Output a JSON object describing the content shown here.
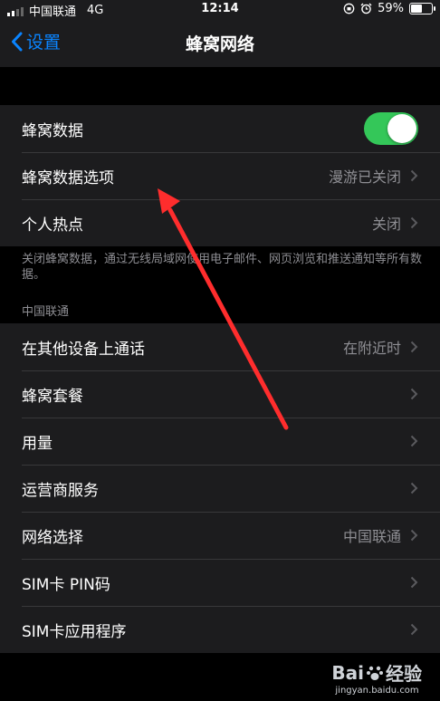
{
  "status_bar": {
    "carrier": "中国联通",
    "network": "4G",
    "time": "12:14",
    "battery_percent": "59%",
    "battery_level": 0.59
  },
  "nav": {
    "back_label": "设置",
    "title": "蜂窝网络"
  },
  "group1": [
    {
      "label": "蜂窝数据",
      "type": "toggle",
      "on": true
    },
    {
      "label": "蜂窝数据选项",
      "value": "漫游已关闭"
    },
    {
      "label": "个人热点",
      "value": "关闭"
    }
  ],
  "footnote": "关闭蜂窝数据，通过无线局域网使用电子邮件、网页浏览和推送通知等所有数据。",
  "section_header": "中国联通",
  "group2": [
    {
      "label": "在其他设备上通话",
      "value": "在附近时"
    },
    {
      "label": "蜂窝套餐",
      "value": ""
    },
    {
      "label": "用量",
      "value": ""
    },
    {
      "label": "运营商服务",
      "value": ""
    },
    {
      "label": "网络选择",
      "value": "中国联通"
    },
    {
      "label": "SIM卡 PIN码",
      "value": ""
    },
    {
      "label": "SIM卡应用程序",
      "value": ""
    }
  ],
  "watermark": {
    "brand": "Bai",
    "brand_suffix": "经验",
    "url": "jingyan.baidu.com"
  },
  "colors": {
    "accent": "#0a84ff",
    "toggle_on": "#34c759",
    "arrow": "#ff2d2d"
  },
  "icons": [
    "chevron-left-icon",
    "chevron-right-icon",
    "signal-icon",
    "alarm-icon",
    "orientation-lock-icon",
    "battery-icon"
  ]
}
